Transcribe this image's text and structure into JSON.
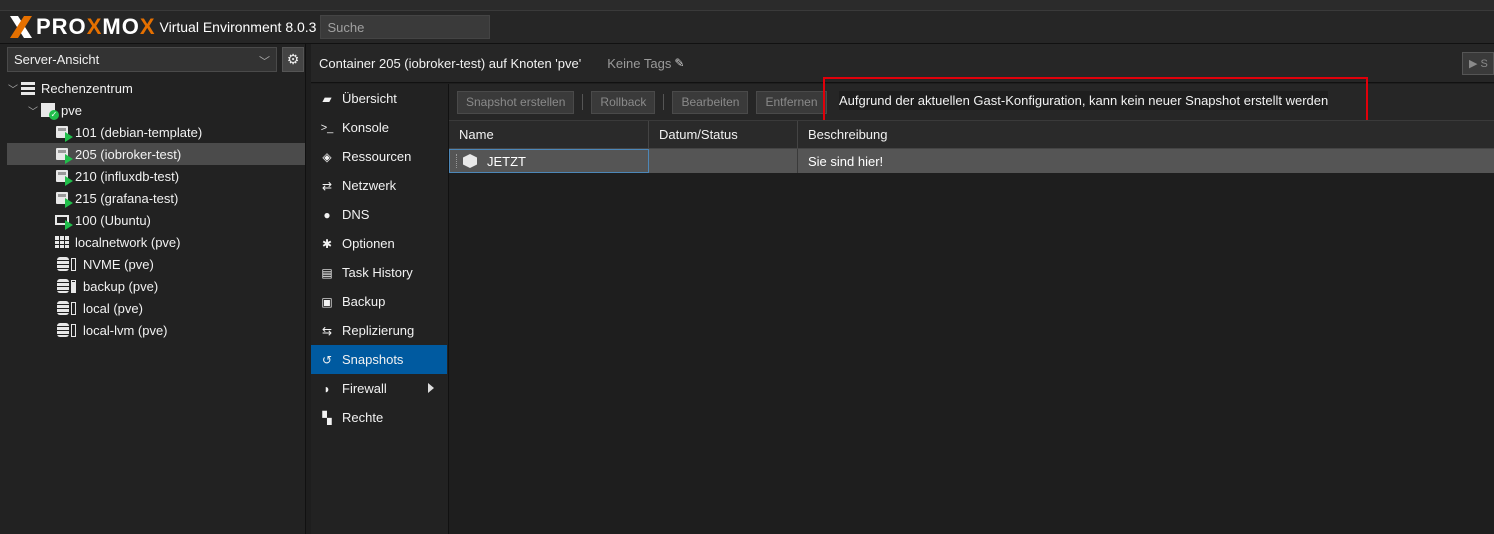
{
  "header": {
    "brand_left": "PRO",
    "brand_x": "X",
    "brand_right": "MO",
    "brand_x2": "X",
    "version": "Virtual Environment 8.0.3",
    "search_placeholder": "Suche"
  },
  "left": {
    "view": "Server-Ansicht",
    "tree": [
      {
        "label": "Rechenzentrum",
        "icon": "datacenter-icon"
      },
      {
        "label": "pve",
        "icon": "node-online-icon"
      },
      {
        "label": "101 (debian-template)",
        "icon": "container-running-icon"
      },
      {
        "label": "205 (iobroker-test)",
        "icon": "container-running-icon"
      },
      {
        "label": "210 (influxdb-test)",
        "icon": "container-running-icon"
      },
      {
        "label": "215 (grafana-test)",
        "icon": "container-running-icon"
      },
      {
        "label": "100 (Ubuntu)",
        "icon": "vm-running-icon"
      },
      {
        "label": "localnetwork (pve)",
        "icon": "sdn-grid-icon"
      },
      {
        "label": "NVME (pve)",
        "icon": "storage-icon"
      },
      {
        "label": "backup (pve)",
        "icon": "storage-icon"
      },
      {
        "label": "local (pve)",
        "icon": "storage-icon"
      },
      {
        "label": "local-lvm (pve)",
        "icon": "storage-icon"
      }
    ]
  },
  "content": {
    "title": "Container 205 (iobroker-test) auf Knoten 'pve'",
    "tags": "Keine Tags",
    "start_label": "S"
  },
  "nav": [
    {
      "label": "Übersicht",
      "icon": "book-icon",
      "glyph": "▰"
    },
    {
      "label": "Konsole",
      "icon": "terminal-icon",
      "glyph": ">_"
    },
    {
      "label": "Ressourcen",
      "icon": "cube-icon",
      "glyph": "◈"
    },
    {
      "label": "Netzwerk",
      "icon": "exchange-icon",
      "glyph": "⇄"
    },
    {
      "label": "DNS",
      "icon": "globe-icon",
      "glyph": "●"
    },
    {
      "label": "Optionen",
      "icon": "gear-icon",
      "glyph": "✱"
    },
    {
      "label": "Task History",
      "icon": "list-icon",
      "glyph": "▤"
    },
    {
      "label": "Backup",
      "icon": "floppy-icon",
      "glyph": "▣"
    },
    {
      "label": "Replizierung",
      "icon": "retweet-icon",
      "glyph": "⇆"
    },
    {
      "label": "Snapshots",
      "icon": "history-icon",
      "glyph": "↺"
    },
    {
      "label": "Firewall",
      "icon": "shield-icon",
      "glyph": "◗"
    },
    {
      "label": "Rechte",
      "icon": "unlock-icon",
      "glyph": "▚"
    }
  ],
  "toolbar": {
    "create": "Snapshot erstellen",
    "rollback": "Rollback",
    "edit": "Bearbeiten",
    "remove": "Entfernen",
    "tooltip": "Aufgrund der aktuellen Gast-Konfiguration, kann kein neuer Snapshot erstellt werden"
  },
  "grid": {
    "columns": [
      "Name",
      "Datum/Status",
      "Beschreibung"
    ],
    "rows": [
      {
        "name": "JETZT",
        "date": "",
        "desc": "Sie sind hier!"
      }
    ]
  },
  "colors": {
    "accent": "#005aa0",
    "brand_orange": "#e57000",
    "running_green": "#21bf4b",
    "highlight_red": "#e0000a"
  }
}
